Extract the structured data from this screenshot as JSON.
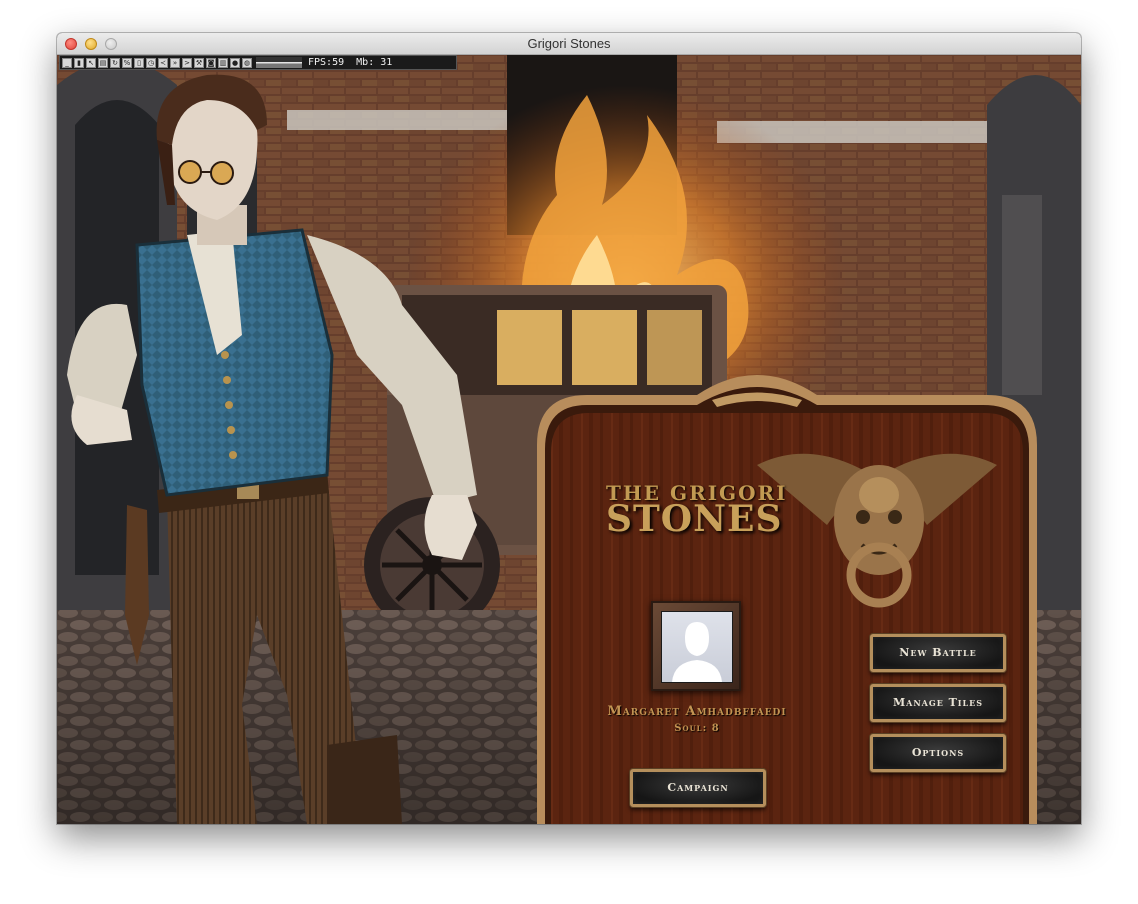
{
  "window": {
    "title": "Grigori Stones"
  },
  "debug_bar": {
    "icon_names": [
      "minimize-icon",
      "chart-icon",
      "cursor-icon",
      "layers-icon",
      "refresh-icon",
      "percent-icon",
      "document-icon",
      "clock-icon",
      "share-icon",
      "fast-forward-icon",
      "terminal-icon",
      "wrench-icon",
      "camera-icon",
      "trash-icon",
      "record-icon",
      "globe-icon"
    ],
    "fps_text": "FPS:59",
    "mb_text": "Mb: 31"
  },
  "menu": {
    "logo_line1": "THE GRIGORI",
    "logo_line2": "STONES",
    "player_name": "Margaret Amhadbffaedi",
    "player_soul": "Soul: 8",
    "buttons": {
      "new_battle": "New Battle",
      "manage_tiles": "Manage Tiles",
      "options": "Options",
      "campaign": "Campaign"
    }
  },
  "colors": {
    "panel_wood": "#5a220f",
    "panel_border": "#8d6b45",
    "gold_text": "#c29352",
    "button_face": "#1e1e1e",
    "button_border": "#b58f5c"
  }
}
